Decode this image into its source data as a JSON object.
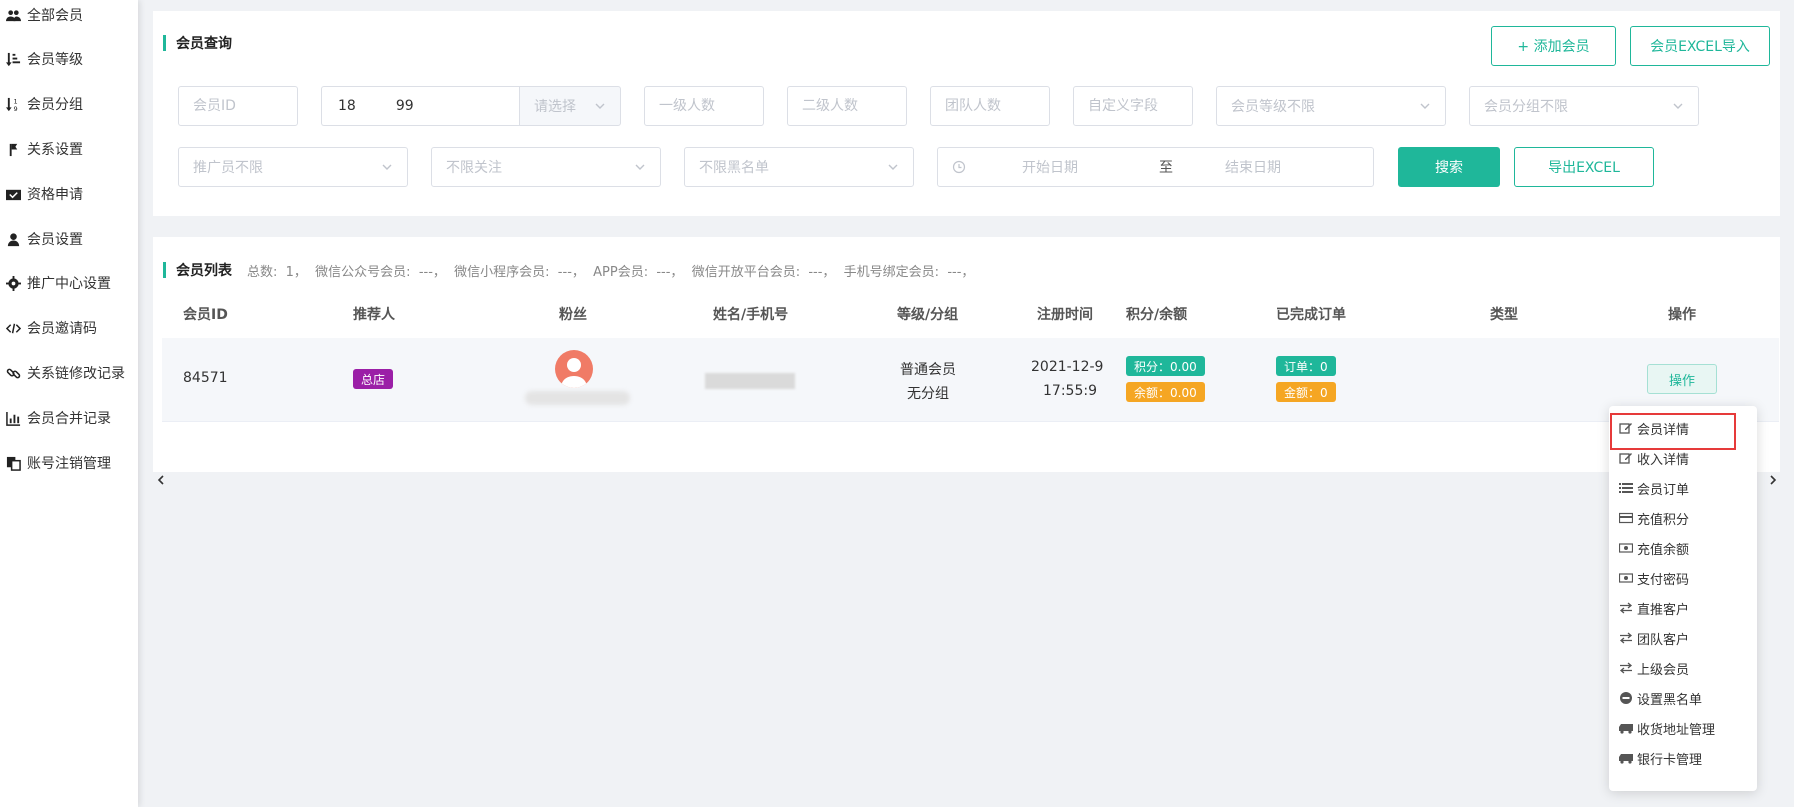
{
  "sidebar": {
    "items": [
      {
        "label": "全部会员",
        "icon": "users-icon"
      },
      {
        "label": "会员等级",
        "icon": "sort-amount-icon"
      },
      {
        "label": "会员分组",
        "icon": "sort-numeric-icon"
      },
      {
        "label": "关系设置",
        "icon": "flag-icon"
      },
      {
        "label": "资格申请",
        "icon": "inbox-icon"
      },
      {
        "label": "会员设置",
        "icon": "user-icon"
      },
      {
        "label": "推广中心设置",
        "icon": "gear-icon"
      },
      {
        "label": "会员邀请码",
        "icon": "code-icon"
      },
      {
        "label": "关系链修改记录",
        "icon": "link-icon"
      },
      {
        "label": "会员合并记录",
        "icon": "bar-chart-icon"
      },
      {
        "label": "账号注销管理",
        "icon": "copy-icon"
      }
    ]
  },
  "query": {
    "title": "会员查询",
    "add_member": "+ 添加会员",
    "import_excel": "会员EXCEL导入",
    "member_id_placeholder": "会员ID",
    "phone_value": "18         99",
    "phone_select_placeholder": "请选择",
    "level1_placeholder": "一级人数",
    "level2_placeholder": "二级人数",
    "team_placeholder": "团队人数",
    "custom_placeholder": "自定义字段",
    "member_level_select": "会员等级不限",
    "member_group_select": "会员分组不限",
    "promoter_select": "推广员不限",
    "follow_select": "不限关注",
    "blacklist_select": "不限黑名单",
    "start_date_placeholder": "开始日期",
    "date_separator": "至",
    "end_date_placeholder": "结束日期",
    "search": "搜索",
    "export_excel": "导出EXCEL"
  },
  "list": {
    "title": "会员列表",
    "stats": "总数:  1，  微信公众号会员:  ---，  微信小程序会员:  ---，  APP会员:  ---，  微信开放平台会员:  ---，  手机号绑定会员:  ---，",
    "columns": [
      "会员ID",
      "推荐人",
      "粉丝",
      "姓名/手机号",
      "等级/分组",
      "注册时间",
      "积分/余额",
      "已完成订单",
      "类型",
      "操作"
    ],
    "rows": [
      {
        "member_id": "84571",
        "referrer_tag": "总店",
        "level": "普通会员",
        "group": "无分组",
        "reg_date": "2021-12-9",
        "reg_time": "17:55:9",
        "points": "积分：0.00",
        "balance": "余额：0.00",
        "orders": "订单：0",
        "amount": "金额：0",
        "action": "操作"
      }
    ]
  },
  "action_menu": {
    "items": [
      {
        "label": "会员详情",
        "icon": "edit-icon"
      },
      {
        "label": "收入详情",
        "icon": "edit-icon"
      },
      {
        "label": "会员订单",
        "icon": "list-icon"
      },
      {
        "label": "充值积分",
        "icon": "credit-card-icon"
      },
      {
        "label": "充值余额",
        "icon": "money-icon"
      },
      {
        "label": "支付密码",
        "icon": "money-icon"
      },
      {
        "label": "直推客户",
        "icon": "exchange-icon"
      },
      {
        "label": "团队客户",
        "icon": "exchange-icon"
      },
      {
        "label": "上级会员",
        "icon": "exchange-icon"
      },
      {
        "label": "设置黑名单",
        "icon": "minus-circle-icon"
      },
      {
        "label": "收货地址管理",
        "icon": "truck-icon"
      },
      {
        "label": "银行卡管理",
        "icon": "truck-icon"
      }
    ]
  },
  "colors": {
    "accent": "#1fb79a",
    "tag_purple": "#9b1fa7",
    "tag_orange": "#f5a623",
    "highlight_red": "#e63a3a"
  }
}
